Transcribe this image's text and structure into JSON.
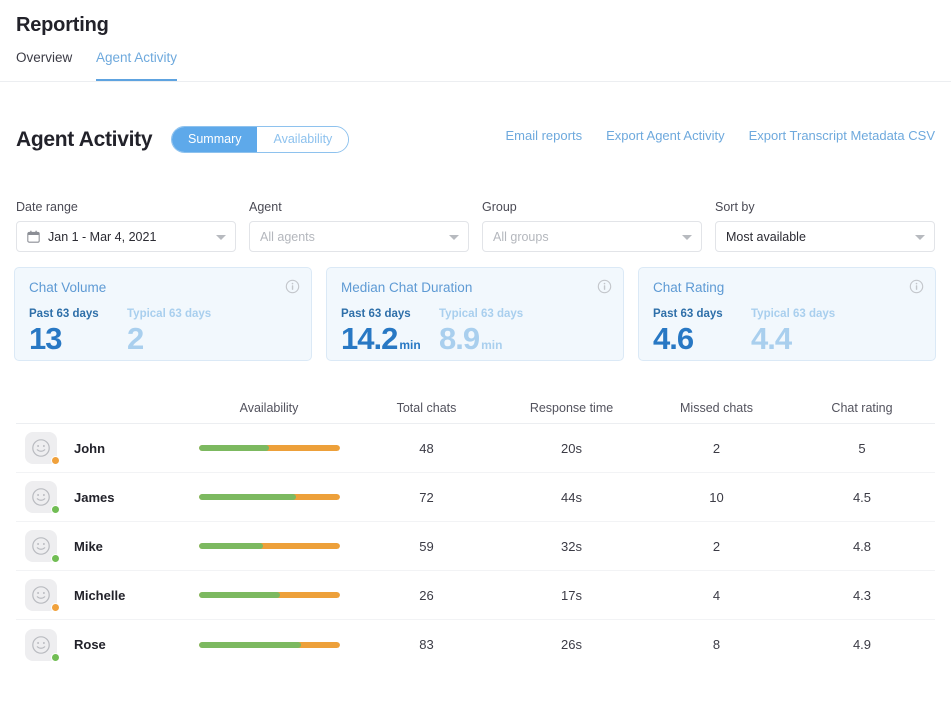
{
  "header": {
    "title": "Reporting",
    "tabs": [
      {
        "label": "Overview",
        "active": false
      },
      {
        "label": "Agent Activity",
        "active": true
      }
    ]
  },
  "section": {
    "title": "Agent Activity",
    "toggle": {
      "active_label": "Summary",
      "inactive_label": "Availability"
    },
    "links": [
      {
        "label": "Email reports"
      },
      {
        "label": "Export Agent Activity"
      },
      {
        "label": "Export Transcript Metadata CSV"
      }
    ]
  },
  "filters": [
    {
      "label": "Date range",
      "value": "Jan 1 - Mar 4, 2021",
      "placeholder": "",
      "is_placeholder": false,
      "icon": "calendar-icon",
      "name": "date-range"
    },
    {
      "label": "Agent",
      "value": "",
      "placeholder": "All agents",
      "is_placeholder": true,
      "icon": "",
      "name": "agent"
    },
    {
      "label": "Group",
      "value": "",
      "placeholder": "All groups",
      "is_placeholder": true,
      "icon": "",
      "name": "group"
    },
    {
      "label": "Sort by",
      "value": "Most available",
      "placeholder": "",
      "is_placeholder": false,
      "icon": "",
      "name": "sort-by"
    }
  ],
  "cards": [
    {
      "title": "Chat Volume",
      "past_label": "Past 63 days",
      "past_value": "13",
      "past_unit": "",
      "typical_label": "Typical 63 days",
      "typical_value": "2",
      "typical_unit": "",
      "info_icon": "info-icon"
    },
    {
      "title": "Median Chat Duration",
      "past_label": "Past 63 days",
      "past_value": "14.2",
      "past_unit": "min",
      "typical_label": "Typical 63 days",
      "typical_value": "8.9",
      "typical_unit": "min",
      "info_icon": "info-icon"
    },
    {
      "title": "Chat Rating",
      "past_label": "Past 63 days",
      "past_value": "4.6",
      "past_unit": "",
      "typical_label": "Typical 63 days",
      "typical_value": "4.4",
      "typical_unit": "",
      "info_icon": "info-icon"
    }
  ],
  "table": {
    "columns": [
      {
        "label": "",
        "key": "agent"
      },
      {
        "label": "Availability",
        "key": "availability"
      },
      {
        "label": "Total chats",
        "key": "total_chats"
      },
      {
        "label": "Response time",
        "key": "response_time"
      },
      {
        "label": "Missed chats",
        "key": "missed_chats"
      },
      {
        "label": "Chat rating",
        "key": "chat_rating"
      }
    ],
    "rows": [
      {
        "name": "John",
        "status": "away",
        "status_color": "#f0a13c",
        "availability_percent": 50,
        "total_chats": "48",
        "response_time": "20s",
        "missed_chats": "2",
        "chat_rating": "5"
      },
      {
        "name": "James",
        "status": "online",
        "status_color": "#71bd54",
        "availability_percent": 69,
        "total_chats": "72",
        "response_time": "44s",
        "missed_chats": "10",
        "chat_rating": "4.5"
      },
      {
        "name": "Mike",
        "status": "online",
        "status_color": "#71bd54",
        "availability_percent": 46,
        "total_chats": "59",
        "response_time": "32s",
        "missed_chats": "2",
        "chat_rating": "4.8"
      },
      {
        "name": "Michelle",
        "status": "away",
        "status_color": "#f0a13c",
        "availability_percent": 58,
        "total_chats": "26",
        "response_time": "17s",
        "missed_chats": "4",
        "chat_rating": "4.3"
      },
      {
        "name": "Rose",
        "status": "online",
        "status_color": "#71bd54",
        "availability_percent": 73,
        "total_chats": "83",
        "response_time": "26s",
        "missed_chats": "8",
        "chat_rating": "4.9"
      }
    ]
  },
  "colors": {
    "accent_blue": "#5ea9ea",
    "link_blue": "#6ea9dd",
    "stat_blue": "#2878c4",
    "stat_blue_light": "#a9cfee",
    "bar_green": "#7cb960",
    "bar_orange": "#eda03a",
    "card_bg": "#f2f8fd"
  }
}
